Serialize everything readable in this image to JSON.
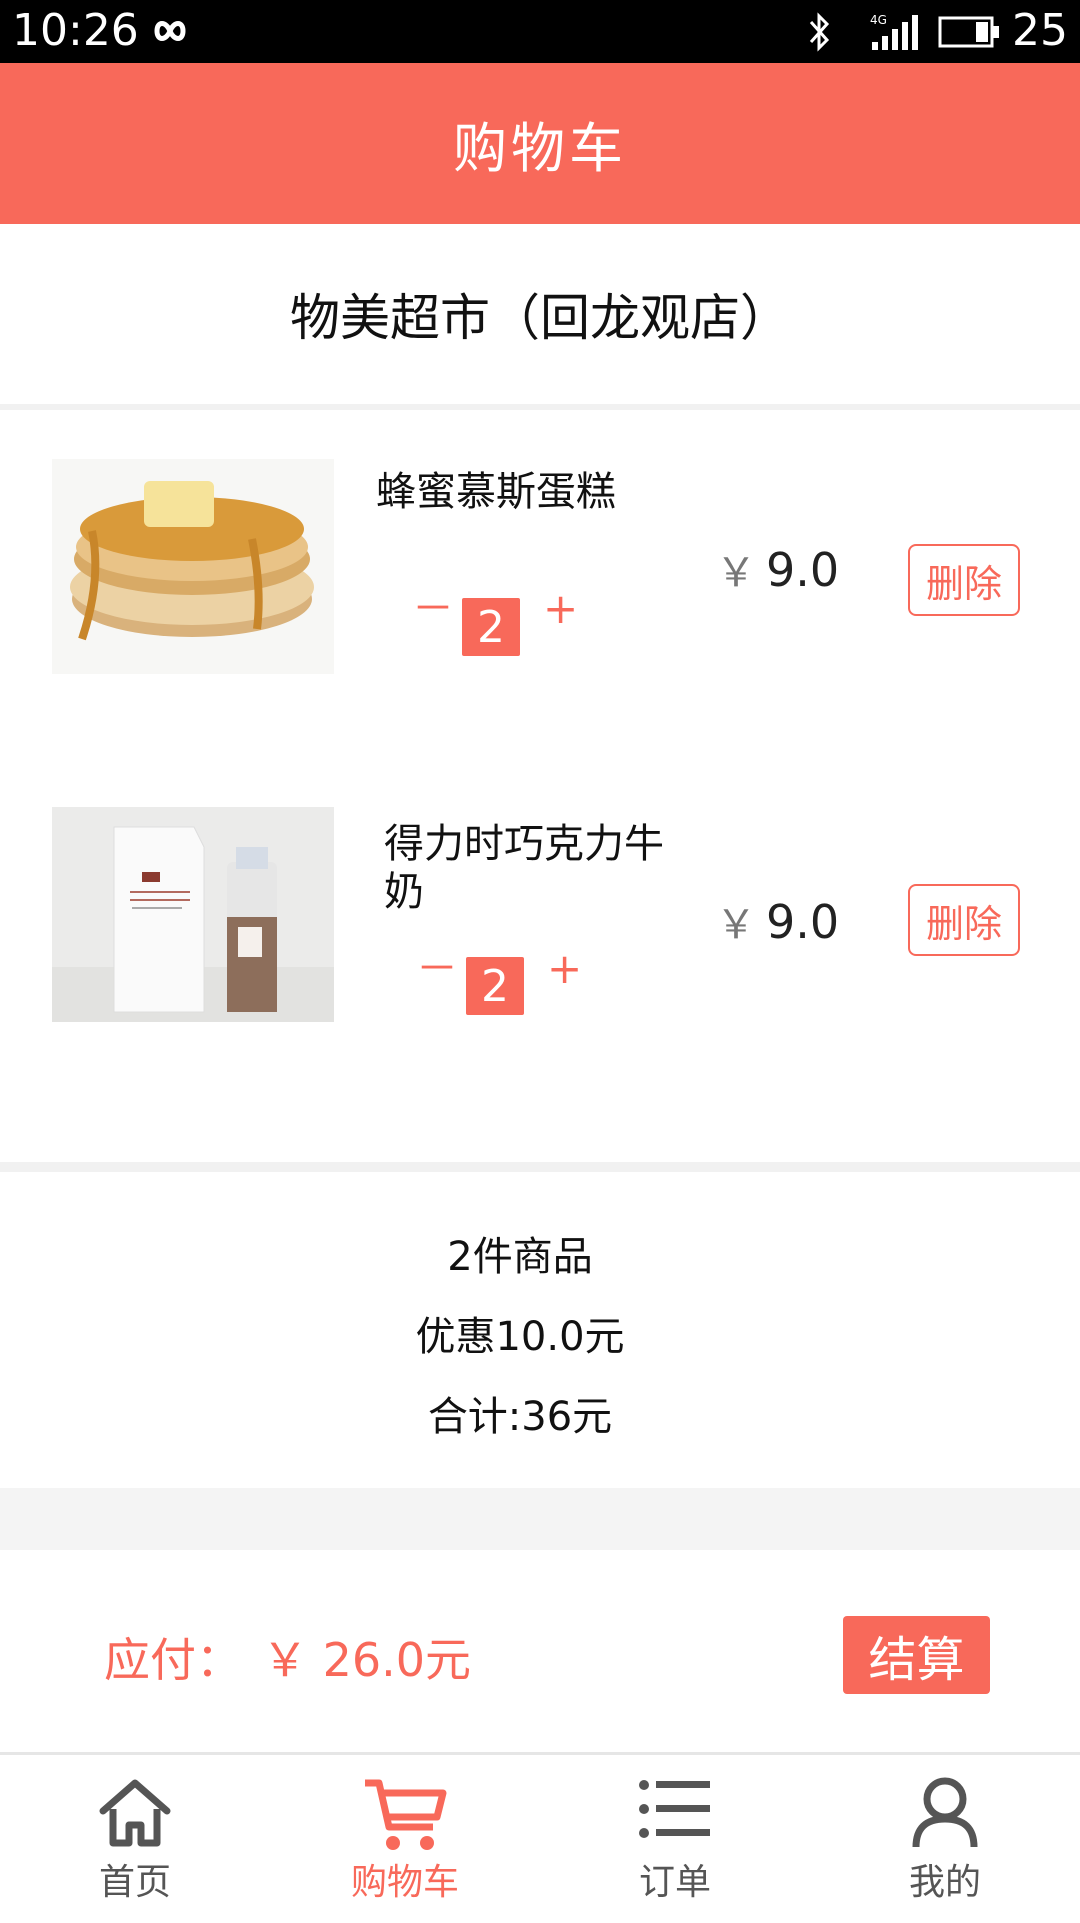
{
  "status_bar": {
    "time": "10:26",
    "battery": "25"
  },
  "header": {
    "title": "购物车"
  },
  "store": {
    "name": "物美超市（回龙观店）"
  },
  "cart_items": [
    {
      "name": "蜂蜜慕斯蛋糕",
      "qty_minus": "－",
      "quantity": "2",
      "qty_plus": "+",
      "currency": "￥",
      "price": "9.0",
      "delete_label": "删除"
    },
    {
      "name": "得力时巧克力牛奶",
      "qty_minus": "－",
      "quantity": "2",
      "qty_plus": "+",
      "currency": "￥",
      "price": "9.0",
      "delete_label": "删除"
    }
  ],
  "summary": {
    "items_count": "2件商品",
    "discount": "优惠10.0元",
    "total": "合计:36元"
  },
  "payment": {
    "label": "应付：",
    "amount": "￥ 26.0元",
    "checkout_label": "结算"
  },
  "tabs": [
    {
      "label": "首页",
      "icon": "home-icon"
    },
    {
      "label": "购物车",
      "icon": "cart-icon",
      "active": true
    },
    {
      "label": "订单",
      "icon": "list-icon"
    },
    {
      "label": "我的",
      "icon": "user-icon"
    }
  ],
  "colors": {
    "accent": "#f8695a",
    "text": "#222222",
    "muted": "#555555"
  }
}
